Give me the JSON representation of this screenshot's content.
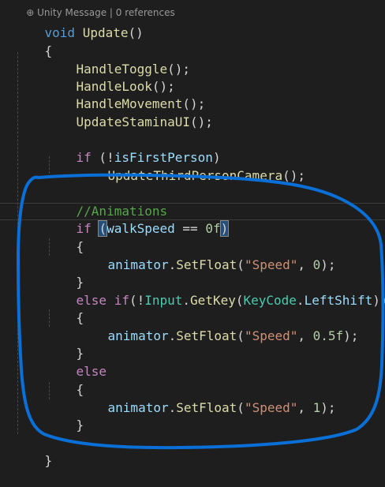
{
  "codelens": "Unity Message | 0 references",
  "sig": {
    "kw": "void",
    "name": "Update",
    "parens": "()"
  },
  "open_brace": "{",
  "close_brace": "}",
  "calls": {
    "toggle": "HandleToggle",
    "look": "HandleLook",
    "move": "HandleMovement",
    "stamina": "UpdateStaminaUI",
    "suffix": "();"
  },
  "fp_if": {
    "kw": "if",
    "open": " (!",
    "var": "isFirstPerson",
    "close": ")"
  },
  "third_person_call": "UpdateThirdPersonCamera",
  "comment": "//Animations",
  "if1": {
    "kw": "if",
    "paren_open": "(",
    "var": "walkSpeed",
    "op": " == ",
    "num": "0f",
    "paren_close": ")"
  },
  "else_if": {
    "kw_else": "else",
    "kw_if": "if",
    "open": "(!",
    "type1": "Input",
    "method": "GetKey",
    "paren": "(",
    "type2": "KeyCode",
    "member": "LeftShift",
    "close": "))"
  },
  "else_kw": "else",
  "setfloat": {
    "obj": "animator",
    "method": "SetFloat",
    "open": "(",
    "str": "\"Speed\"",
    "comma": ", ",
    "close": ");",
    "values": [
      "0",
      "0.5f",
      "1"
    ]
  },
  "colors": {
    "background": "#1e1e1e",
    "keyword": "#569cd6",
    "control": "#c586c0",
    "function": "#dcdcaa",
    "type": "#4ec9b0",
    "variable": "#9cdcfe",
    "string": "#ce9178",
    "number": "#b5cea8",
    "comment": "#57a64a",
    "ink_annotation": "#0a6fd6"
  }
}
